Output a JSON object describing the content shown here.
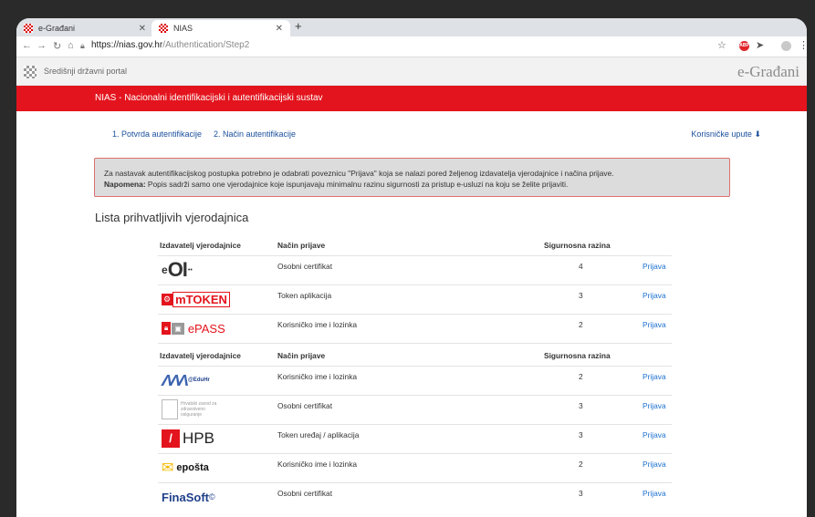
{
  "browser": {
    "tabs": [
      {
        "title": "e-Građani",
        "active": false
      },
      {
        "title": "NIAS",
        "active": true
      }
    ],
    "url_domain": "https://nias.gov.hr",
    "url_path": "/Authentication/Step2"
  },
  "portal": {
    "title": "Središnji državni portal",
    "brand": "e-Građani"
  },
  "header": {
    "title": "NIAS - Nacionalni identifikacijski i autentifikacijski sustav"
  },
  "steps": {
    "step1": "1. Potvrda autentifikacije",
    "step2": "2. Način autentifikacije",
    "manual": "Korisničke upute"
  },
  "alert": {
    "line1": "Za nastavak autentifikacijskog postupka potrebno je odabrati poveznicu \"Prijava\" koja se nalazi pored željenog izdavatelja vjerodajnice i načina prijave.",
    "note_label": "Napomena:",
    "note_text": " Popis sadrži samo one vjerodajnice koje ispunjavaju minimalnu razinu sigurnosti za pristup e-usluzi na koju se želite prijaviti."
  },
  "list_title": "Lista prihvatljivih vjerodajnica",
  "table_headers": {
    "issuer": "Izdavatelj vjerodajnice",
    "method": "Način prijave",
    "level": "Sigurnosna razina"
  },
  "groups": [
    {
      "rows": [
        {
          "logo": "eOI",
          "method": "Osobni certifikat",
          "level": "4",
          "action": "Prijava"
        },
        {
          "logo": "mTOKEN",
          "method": "Token aplikacija",
          "level": "3",
          "action": "Prijava"
        },
        {
          "logo": "ePASS",
          "method": "Korisničko ime i lozinka",
          "level": "2",
          "action": "Prijava"
        }
      ]
    },
    {
      "rows": [
        {
          "logo": "AAI@EduHr",
          "method": "Korisničko ime i lozinka",
          "level": "2",
          "action": "Prijava"
        },
        {
          "logo": "HZZO",
          "method": "Osobni certifikat",
          "level": "3",
          "action": "Prijava"
        },
        {
          "logo": "HPB",
          "method": "Token uređaj / aplikacija",
          "level": "3",
          "action": "Prijava"
        },
        {
          "logo": "ePošta",
          "method": "Korisničko ime i lozinka",
          "level": "2",
          "action": "Prijava"
        },
        {
          "logo": "FinaSoft",
          "method": "Osobni certifikat",
          "level": "3",
          "action": "Prijava"
        }
      ]
    }
  ],
  "logos": {
    "eoi": "eOI",
    "mtoken": "mTOKEN",
    "epass": "ePASS",
    "eduhr": "@EduHr",
    "hzzo": "Hrvatski zavod za zdravstveno osiguranje",
    "hpb": "HPB",
    "eposta": "epošta",
    "finasoft": "FinaSoft"
  },
  "colors": {
    "red_bar": "#e3141d",
    "link": "#1a6fd0"
  }
}
